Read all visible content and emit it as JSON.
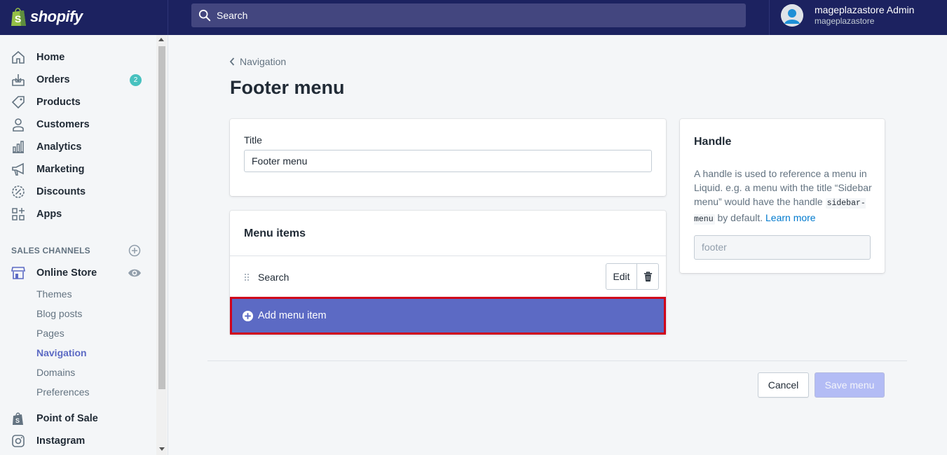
{
  "topbar": {
    "brand": "shopify",
    "search_placeholder": "Search",
    "user_name": "mageplazastore Admin",
    "store_name": "mageplazastore"
  },
  "sidebar": {
    "items": [
      {
        "label": "Home",
        "icon": "home-icon"
      },
      {
        "label": "Orders",
        "icon": "orders-icon",
        "badge": "2"
      },
      {
        "label": "Products",
        "icon": "tag-icon"
      },
      {
        "label": "Customers",
        "icon": "person-icon"
      },
      {
        "label": "Analytics",
        "icon": "bar-chart-icon"
      },
      {
        "label": "Marketing",
        "icon": "megaphone-icon"
      },
      {
        "label": "Discounts",
        "icon": "discount-icon"
      },
      {
        "label": "Apps",
        "icon": "apps-icon"
      }
    ],
    "sales_channels_label": "SALES CHANNELS",
    "online_store": {
      "label": "Online Store",
      "sub_items": [
        "Themes",
        "Blog posts",
        "Pages",
        "Navigation",
        "Domains",
        "Preferences"
      ],
      "active": "Navigation"
    },
    "point_of_sale": "Point of Sale",
    "instagram": "Instagram"
  },
  "main": {
    "breadcrumb": "Navigation",
    "page_title": "Footer menu",
    "title_card": {
      "label": "Title",
      "value": "Footer menu"
    },
    "menu_items": {
      "header": "Menu items",
      "rows": [
        {
          "label": "Search",
          "edit_label": "Edit"
        }
      ],
      "add_label": "Add menu item"
    },
    "handle_card": {
      "title": "Handle",
      "desc_1": "A handle is used to reference a menu in Liquid. e.g. a menu with the title “Sidebar menu” would have the handle ",
      "code": "sidebar-menu",
      "desc_2": " by default. ",
      "link": "Learn more",
      "value": "footer"
    },
    "cancel_label": "Cancel",
    "save_label": "Save menu"
  },
  "colors": {
    "topbar": "#1c2260",
    "accent": "#5c6ac4",
    "highlight_border": "#d0021b",
    "badge": "#47c1bf"
  }
}
